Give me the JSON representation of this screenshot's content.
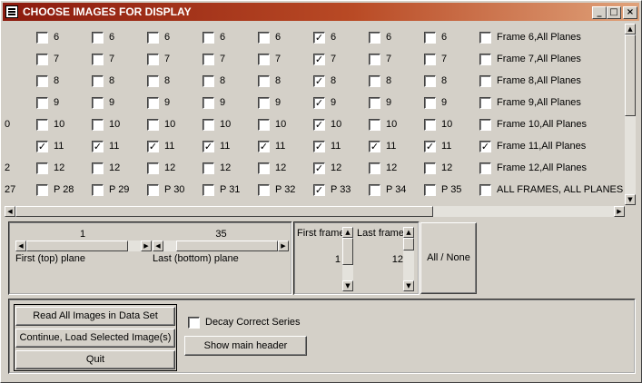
{
  "window": {
    "title": "CHOOSE IMAGES FOR DISPLAY",
    "minimize": "_",
    "maximize": "□",
    "close": "×"
  },
  "left_edge_labels": [
    "",
    "",
    "",
    "",
    "0",
    "",
    "2",
    "27"
  ],
  "columns": [
    {
      "rows": [
        {
          "label": "6",
          "checked": false
        },
        {
          "label": "7",
          "checked": false
        },
        {
          "label": "8",
          "checked": false
        },
        {
          "label": "9",
          "checked": false
        },
        {
          "label": "10",
          "checked": false
        },
        {
          "label": "11",
          "checked": true
        },
        {
          "label": "12",
          "checked": false
        },
        {
          "label": "P 28",
          "checked": false
        }
      ]
    },
    {
      "rows": [
        {
          "label": "6",
          "checked": false
        },
        {
          "label": "7",
          "checked": false
        },
        {
          "label": "8",
          "checked": false
        },
        {
          "label": "9",
          "checked": false
        },
        {
          "label": "10",
          "checked": false
        },
        {
          "label": "11",
          "checked": true
        },
        {
          "label": "12",
          "checked": false
        },
        {
          "label": "P 29",
          "checked": false
        }
      ]
    },
    {
      "rows": [
        {
          "label": "6",
          "checked": false
        },
        {
          "label": "7",
          "checked": false
        },
        {
          "label": "8",
          "checked": false
        },
        {
          "label": "9",
          "checked": false
        },
        {
          "label": "10",
          "checked": false
        },
        {
          "label": "11",
          "checked": true
        },
        {
          "label": "12",
          "checked": false
        },
        {
          "label": "P 30",
          "checked": false
        }
      ]
    },
    {
      "rows": [
        {
          "label": "6",
          "checked": false
        },
        {
          "label": "7",
          "checked": false
        },
        {
          "label": "8",
          "checked": false
        },
        {
          "label": "9",
          "checked": false
        },
        {
          "label": "10",
          "checked": false
        },
        {
          "label": "11",
          "checked": true
        },
        {
          "label": "12",
          "checked": false
        },
        {
          "label": "P 31",
          "checked": false
        }
      ]
    },
    {
      "rows": [
        {
          "label": "6",
          "checked": false
        },
        {
          "label": "7",
          "checked": false
        },
        {
          "label": "8",
          "checked": false
        },
        {
          "label": "9",
          "checked": false
        },
        {
          "label": "10",
          "checked": false
        },
        {
          "label": "11",
          "checked": true
        },
        {
          "label": "12",
          "checked": false
        },
        {
          "label": "P 32",
          "checked": false
        }
      ]
    },
    {
      "rows": [
        {
          "label": "6",
          "checked": true
        },
        {
          "label": "7",
          "checked": true
        },
        {
          "label": "8",
          "checked": true
        },
        {
          "label": "9",
          "checked": true
        },
        {
          "label": "10",
          "checked": true
        },
        {
          "label": "11",
          "checked": true
        },
        {
          "label": "12",
          "checked": true
        },
        {
          "label": "P 33",
          "checked": true
        }
      ]
    },
    {
      "rows": [
        {
          "label": "6",
          "checked": false
        },
        {
          "label": "7",
          "checked": false
        },
        {
          "label": "8",
          "checked": false
        },
        {
          "label": "9",
          "checked": false
        },
        {
          "label": "10",
          "checked": false
        },
        {
          "label": "11",
          "checked": true
        },
        {
          "label": "12",
          "checked": false
        },
        {
          "label": "P 34",
          "checked": false
        }
      ]
    },
    {
      "rows": [
        {
          "label": "6",
          "checked": false
        },
        {
          "label": "7",
          "checked": false
        },
        {
          "label": "8",
          "checked": false
        },
        {
          "label": "9",
          "checked": false
        },
        {
          "label": "10",
          "checked": false
        },
        {
          "label": "11",
          "checked": true
        },
        {
          "label": "12",
          "checked": false
        },
        {
          "label": "P 35",
          "checked": false
        }
      ]
    },
    {
      "rows": [
        {
          "label": "Frame 6,All Planes",
          "checked": false
        },
        {
          "label": "Frame 7,All Planes",
          "checked": false
        },
        {
          "label": "Frame 8,All Planes",
          "checked": false
        },
        {
          "label": "Frame 9,All Planes",
          "checked": false
        },
        {
          "label": "Frame 10,All Planes",
          "checked": false
        },
        {
          "label": "Frame 11,All Planes",
          "checked": true
        },
        {
          "label": "Frame 12,All Planes",
          "checked": false
        },
        {
          "label": "ALL FRAMES, ALL PLANES",
          "checked": false
        }
      ]
    }
  ],
  "planes": {
    "first_value": "1",
    "first_label": "First (top) plane",
    "last_value": "35",
    "last_label": "Last (bottom) plane",
    "first_slider_fraction": 0.0,
    "last_slider_fraction": 1.0
  },
  "frames": {
    "first_label": "First frame",
    "first_value": "1",
    "last_label": "Last frame",
    "last_value": "12"
  },
  "all_none_label": "All / None",
  "actions": {
    "read_all": "Read All Images in Data Set",
    "continue": "Continue, Load Selected Image(s)",
    "quit": "Quit",
    "decay_label": "Decay Correct Series",
    "decay_checked": false,
    "show_header": "Show main header"
  },
  "check_glyph": "✓"
}
